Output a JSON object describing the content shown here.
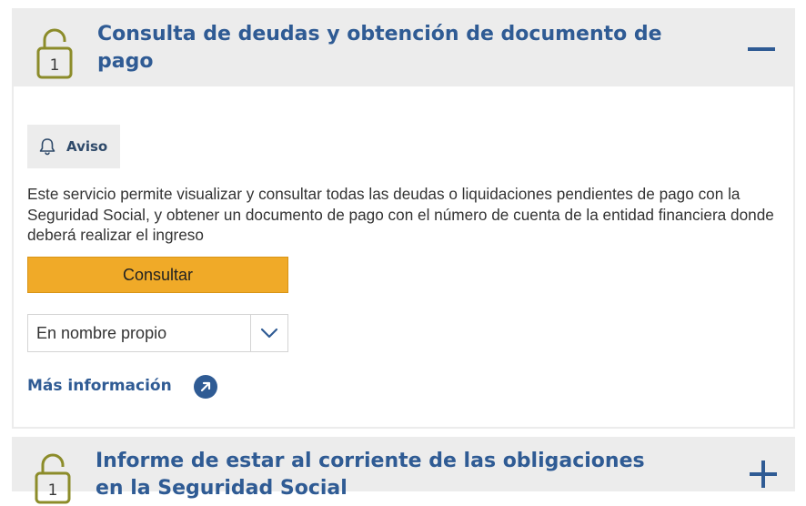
{
  "cards": [
    {
      "title": "Consulta de deudas y obtención de documento de pago",
      "level_icon": "lock-level-1",
      "level_number": "1",
      "toggle": "minus",
      "aviso_label": "Aviso",
      "description": "Este servicio permite visualizar y consultar todas las deudas o liquidaciones pendientes de pago con la Seguridad Social, y obtener un documento de pago con el número de cuenta de la entidad financiera donde deberá realizar el ingreso",
      "button_label": "Consultar",
      "select_value": "En nombre propio",
      "more_info_label": "Más información"
    },
    {
      "title": "Informe de estar al corriente de las obligaciones en la Seguridad Social",
      "level_icon": "lock-level-1",
      "level_number": "1",
      "toggle": "plus"
    }
  ],
  "colors": {
    "title": "#2f5b94",
    "button": "#f0aa28",
    "header_bg": "#ececec",
    "lock_icon": "#8c8c2a"
  }
}
